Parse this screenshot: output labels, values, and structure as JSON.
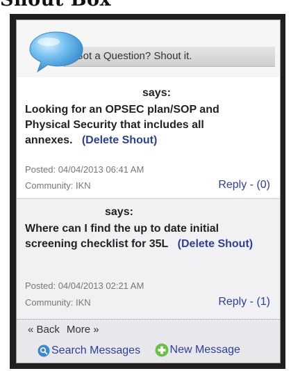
{
  "page": {
    "heading": "Shout Box"
  },
  "header": {
    "title": "Got a Question? Shout it."
  },
  "shouts": [
    {
      "says": "says:",
      "message": "Looking for an OPSEC plan/SOP and Physical Security that includes all annexes.",
      "delete_label": "(Delete Shout)",
      "posted": "Posted: 04/04/2013 06:41 AM",
      "community": "Community: IKN",
      "reply": "Reply - (0)"
    },
    {
      "says": "says:",
      "message": "Where can I find the up to date initial screening checklist for 35L",
      "delete_label": "(Delete Shout)",
      "posted": "Posted: 04/04/2013 02:21 AM",
      "community": "Community: IKN",
      "reply": "Reply - (1)"
    }
  ],
  "footer": {
    "back": "« Back",
    "more": "More »",
    "search": "Search Messages",
    "new_message": "New Message"
  },
  "colors": {
    "link": "#2d3f99",
    "bubble": "#5aa9df",
    "plus": "#6cbf4a"
  }
}
